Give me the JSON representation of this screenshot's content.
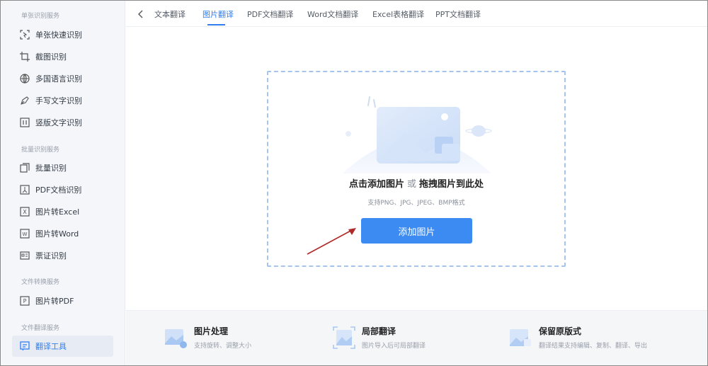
{
  "sidebar": {
    "sections": [
      {
        "title": "单张识别服务",
        "items": [
          {
            "label": "单张快速识别",
            "icon": "quick-scan-icon"
          },
          {
            "label": "截图识别",
            "icon": "crop-icon"
          },
          {
            "label": "多国语言识别",
            "icon": "globe-icon"
          },
          {
            "label": "手写文字识别",
            "icon": "pen-icon"
          },
          {
            "label": "竖版文字识别",
            "icon": "vertical-text-icon"
          }
        ]
      },
      {
        "title": "批量识别服务",
        "items": [
          {
            "label": "批量识别",
            "icon": "batch-icon"
          },
          {
            "label": "PDF文档识别",
            "icon": "pdf-icon"
          },
          {
            "label": "图片转Excel",
            "icon": "excel-icon"
          },
          {
            "label": "图片转Word",
            "icon": "word-icon"
          },
          {
            "label": "票证识别",
            "icon": "ticket-icon"
          }
        ]
      },
      {
        "title": "文件转换服务",
        "items": [
          {
            "label": "图片转PDF",
            "icon": "pdf-convert-icon"
          }
        ]
      },
      {
        "title": "文件翻译服务",
        "items": [
          {
            "label": "翻译工具",
            "icon": "translate-icon",
            "active": true
          }
        ]
      }
    ]
  },
  "tabs": [
    "文本翻译",
    "图片翻译",
    "PDF文档翻译",
    "Word文档翻译",
    "Excel表格翻译",
    "PPT文档翻译"
  ],
  "active_tab": "图片翻译",
  "upload": {
    "title_click": "点击添加图片",
    "title_or": "或",
    "title_drag": "拖拽图片到此处",
    "hint": "支持PNG、JPG、JPEG、BMP格式",
    "button": "添加图片"
  },
  "features": [
    {
      "title": "图片处理",
      "desc": "支持旋转、调整大小",
      "icon": "image-process-icon"
    },
    {
      "title": "局部翻译",
      "desc": "图片导入后可局部翻译",
      "icon": "partial-translate-icon"
    },
    {
      "title": "保留原版式",
      "desc": "翻译结果支持编辑、复制、翻译、导出",
      "icon": "keep-layout-icon"
    }
  ],
  "colors": {
    "accent": "#2f7ff0",
    "button": "#3c8bf2",
    "dashed_border": "#a5c5ee",
    "annotation_arrow": "#b02a2a"
  }
}
